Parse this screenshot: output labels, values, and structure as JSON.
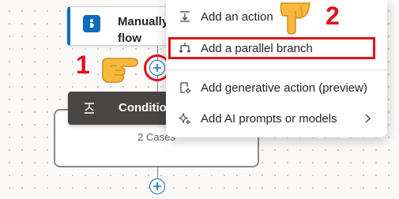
{
  "canvas": {
    "trigger": {
      "title": "Manually\nflow",
      "icon": "manual-trigger-icon"
    },
    "condition": {
      "title": "Condition",
      "cases": "2 Cases",
      "icon": "condition-icon"
    },
    "add_button_icon": "plus-icon"
  },
  "menu": {
    "items": [
      {
        "label": "Add an action",
        "icon": "add-action-icon"
      },
      {
        "label": "Add a parallel branch",
        "icon": "parallel-branch-icon"
      },
      {
        "label": "Add generative action (preview)",
        "icon": "generative-action-icon"
      },
      {
        "label": "Add AI prompts or models",
        "icon": "ai-sparkle-icon",
        "has_submenu": true
      }
    ]
  },
  "annotations": {
    "step1": "1",
    "step2": "2",
    "highlight_color": "#e0121b"
  },
  "colors": {
    "accent": "#0f6cbd",
    "condition_header": "#484644",
    "annotation_red": "#e0121b"
  }
}
